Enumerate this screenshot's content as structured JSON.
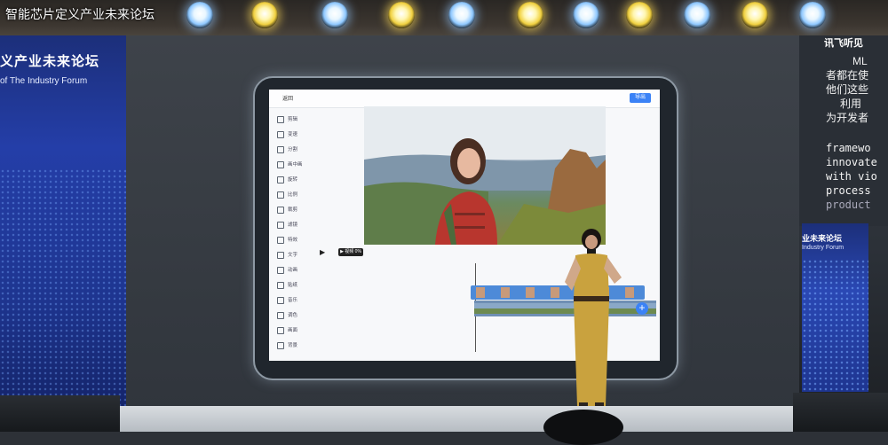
{
  "caption": "智能芯片定义产业未来论坛",
  "left_banner": {
    "title_cn": "义产业未来论坛",
    "title_en": "of The Industry Forum"
  },
  "right_screen": {
    "brand": "讯飞听见",
    "lines": [
      "ML",
      "者都在使",
      "他们这些",
      "利用",
      "为开发者"
    ],
    "lines_en": [
      "framewo",
      "innovate",
      "with vio",
      "process",
      "product"
    ]
  },
  "right_banner": {
    "title_cn": "业未来论坛",
    "title_en": "Industry Forum"
  },
  "app": {
    "back_label": "返回",
    "export_label": "导出",
    "time_label": "▶ 视频 0%",
    "tools": [
      "剪辑",
      "变速",
      "分割",
      "画中画",
      "旋转",
      "比例",
      "裁剪",
      "滤镜",
      "特效",
      "文字",
      "动画",
      "贴纸",
      "音乐",
      "调色",
      "画面",
      "背景"
    ]
  },
  "colors": {
    "accent": "#3b82f6",
    "banner": "#243ea8"
  }
}
